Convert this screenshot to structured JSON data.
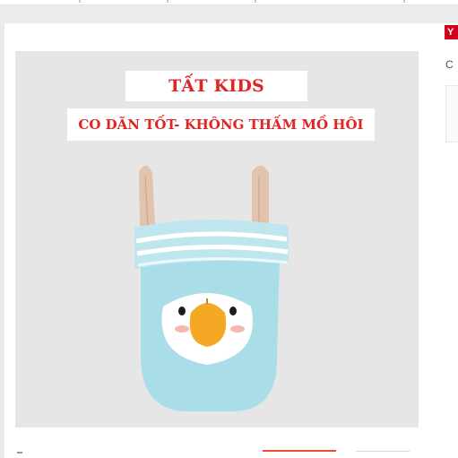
{
  "product": {
    "image_alt": "Tất kids - vớ trẻ em hình chim cánh cụt xanh",
    "banner_title": "TẤT KIDS",
    "banner_subtitle": "CO DÃN TỐT- KHÔNG THẤM MỒ HÔI",
    "text_color": "#e02323"
  },
  "side_panel": {
    "badge_text": "Y",
    "badge_color": "#d0011b",
    "caption_text": "C"
  },
  "colors": {
    "page_bg": "#ebebeb",
    "image_bg": "#e6e6e6",
    "sock_blue": "#a9dde8",
    "beak_orange": "#f4a823",
    "accent": "#ee4d2d"
  }
}
